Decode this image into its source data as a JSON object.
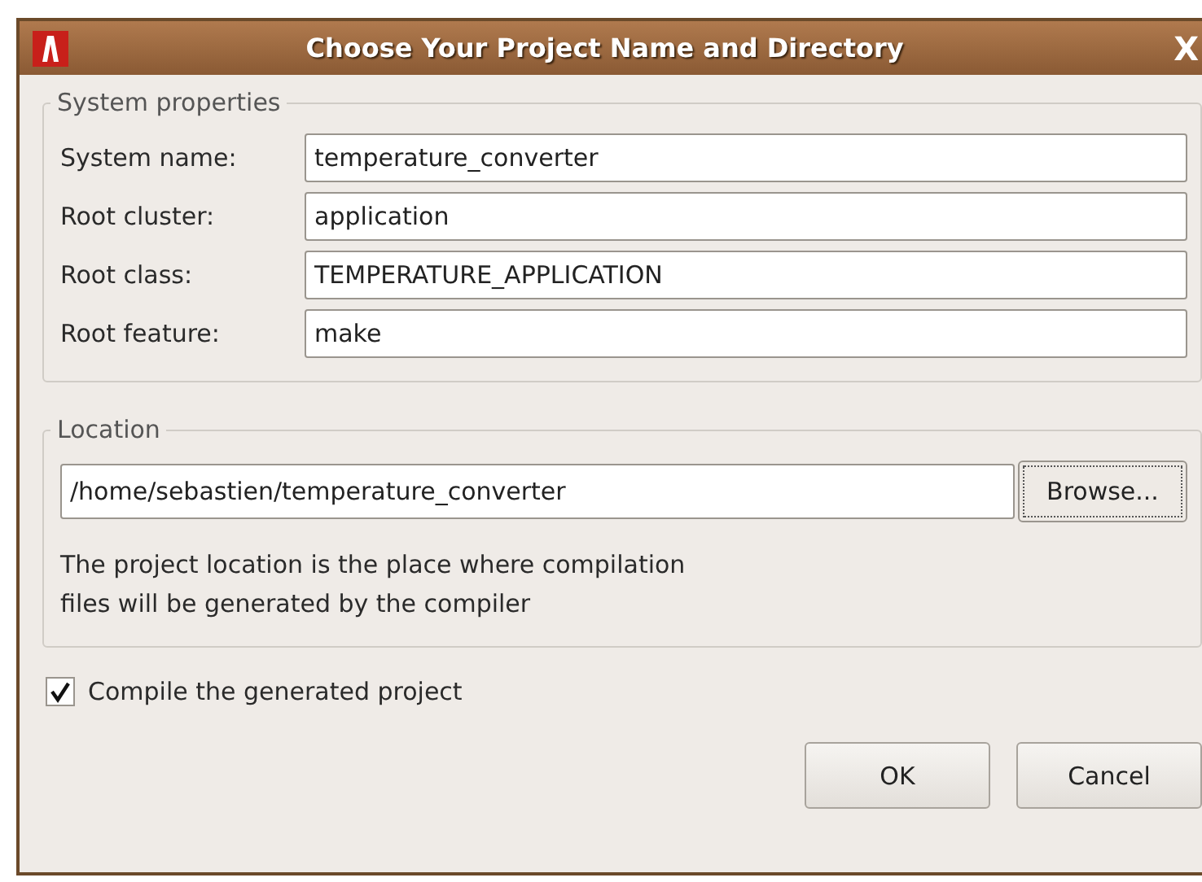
{
  "window": {
    "title": "Choose Your Project Name and Directory",
    "close": "X"
  },
  "system_properties": {
    "title": "System properties",
    "fields": [
      {
        "label": "System name:",
        "value": "temperature_converter"
      },
      {
        "label": "Root cluster:",
        "value": "application"
      },
      {
        "label": "Root class:",
        "value": "TEMPERATURE_APPLICATION"
      },
      {
        "label": "Root feature:",
        "value": "make"
      }
    ]
  },
  "location": {
    "title": "Location",
    "path": "/home/sebastien/temperature_converter",
    "browse": "Browse...",
    "help": [
      "The project location is the place where compilation",
      "files will be generated by the compiler"
    ]
  },
  "compile": {
    "label": "Compile the generated project",
    "checked": true
  },
  "buttons": [
    "OK",
    "Cancel"
  ]
}
